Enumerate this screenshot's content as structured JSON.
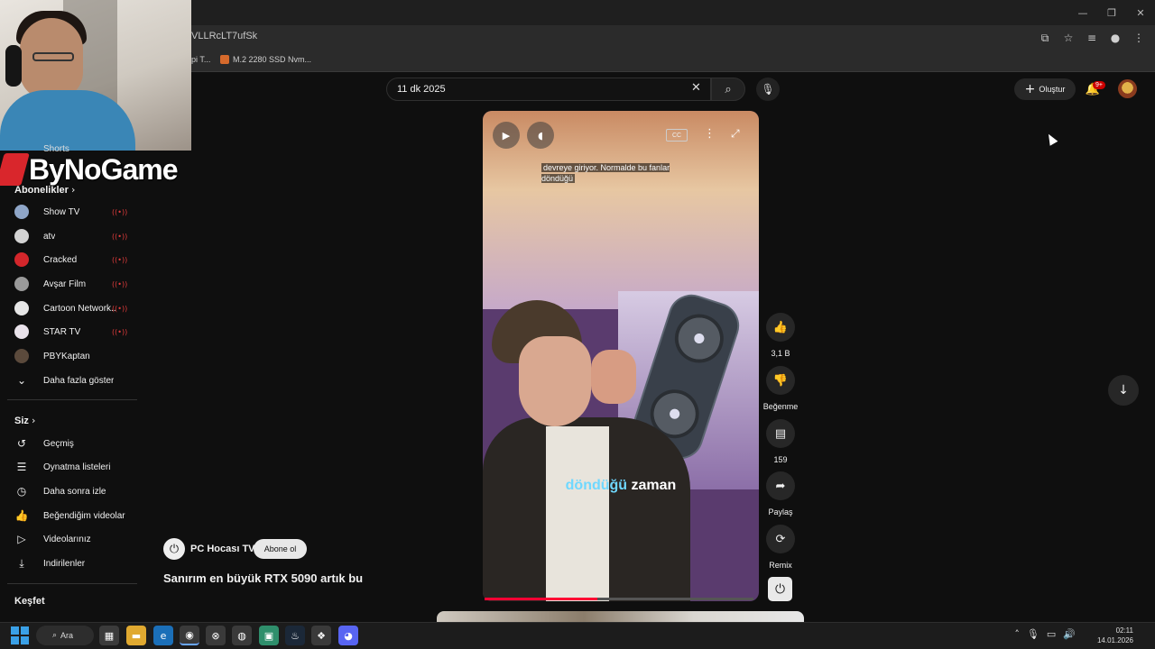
{
  "browser": {
    "url_fragment": "VLLRcLT7ufSk",
    "bookmarks": [
      "pi T...",
      "M.2 2280 SSD Nvm..."
    ]
  },
  "overlay": {
    "logo_text": "ByNoGame",
    "shorts_label": "Shorts"
  },
  "youtube": {
    "search_value": "11 dk 2025",
    "create_label": "Oluştur",
    "notif_badge": "9+"
  },
  "sidebar": {
    "subscriptions_heading": "Abonelikler",
    "subscriptions": [
      {
        "label": "Show TV",
        "icon_color": "#8fa6c8"
      },
      {
        "label": "atv",
        "icon_color": "#d3d3d3"
      },
      {
        "label": "Cracked",
        "icon_color": "#d3262b"
      },
      {
        "label": "Avşar Film",
        "icon_color": "#9a9a9a"
      },
      {
        "label": "Cartoon Network...",
        "icon_color": "#e6e6e6"
      },
      {
        "label": "STAR TV",
        "icon_color": "#e9e2ea"
      },
      {
        "label": "PBYKaptan",
        "icon_color": "#5b4a3c"
      }
    ],
    "show_more": "Daha fazla göster",
    "you_heading": "Siz",
    "you_items": [
      "Geçmiş",
      "Oynatma listeleri",
      "Daha sonra izle",
      "Beğendiğim videolar",
      "Videolarınız",
      "İndirilenler"
    ],
    "explore_heading": "Keşfet"
  },
  "video": {
    "caption_top": "devreye giriyor. Normalde bu fanlar döndüğü",
    "caption_highlight": "döndüğü",
    "caption_rest": "zaman",
    "progress": 0.42,
    "channel_name": "PC Hocası TV",
    "subscribe_label": "Abone ol",
    "title": "Sanırım en büyük RTX 5090 artık bu"
  },
  "actions": {
    "like_count": "3,1 B",
    "dislike_label": "Beğenme",
    "comment_count": "159",
    "share_label": "Paylaş",
    "remix_label": "Remix"
  },
  "taskbar": {
    "search_label": "Ara",
    "time": "02:11",
    "date": "14.01.2026"
  }
}
